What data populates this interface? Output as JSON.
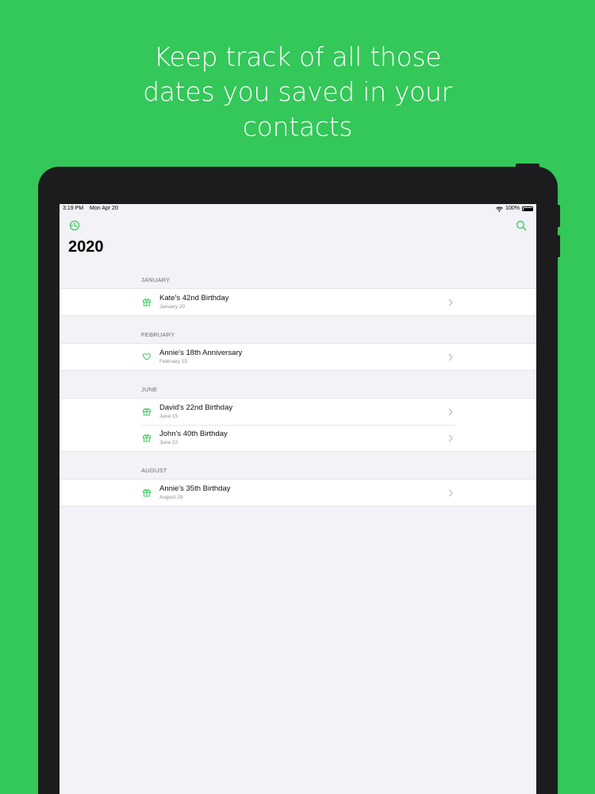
{
  "headline": {
    "line1": "Keep track of all those",
    "line2": "dates you saved in your",
    "line3": "contacts"
  },
  "colors": {
    "background": "#34c759",
    "accent": "#34c759",
    "device": "#1c1c1e",
    "screen": "#f2f2f7"
  },
  "status_bar": {
    "time": "3:19 PM",
    "date": "Mon Apr 20",
    "battery": "100%"
  },
  "nav": {
    "left_icon": "clock-icon",
    "right_icon": "search-icon"
  },
  "title": "2020",
  "sections": [
    {
      "header": "JANUARY",
      "items": [
        {
          "title": "Kate's 42nd Birthday",
          "date": "January 20",
          "icon": "gift-icon"
        }
      ]
    },
    {
      "header": "FEBRUARY",
      "items": [
        {
          "title": "Annie's 18th Anniversary",
          "date": "February 15",
          "icon": "heart-icon"
        }
      ]
    },
    {
      "header": "JUNE",
      "items": [
        {
          "title": "David's 22nd Birthday",
          "date": "June 15",
          "icon": "gift-icon"
        },
        {
          "title": "John's 40th Birthday",
          "date": "June 22",
          "icon": "gift-icon"
        }
      ]
    },
    {
      "header": "AUGUST",
      "items": [
        {
          "title": "Annie's 35th Birthday",
          "date": "August 29",
          "icon": "gift-icon"
        }
      ]
    }
  ]
}
